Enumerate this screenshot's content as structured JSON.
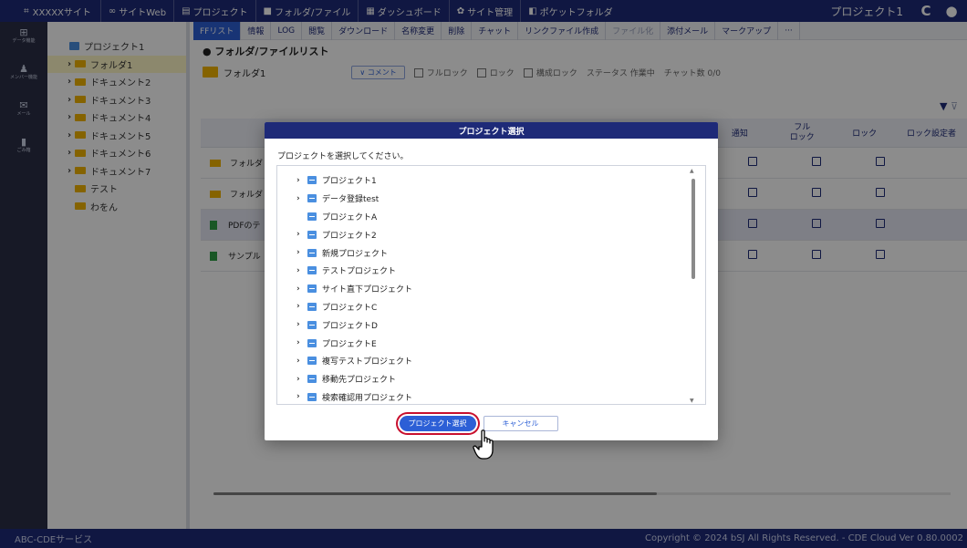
{
  "topbar": {
    "brand": "XXXXXサイト",
    "nav": [
      "サイトWeb",
      "プロジェクト",
      "フォルダ/ファイル",
      "ダッシュボード",
      "サイト管理",
      "ポケットフォルダ"
    ],
    "project_name": "プロジェクト1"
  },
  "rail": [
    "データ機能",
    "メンバー機能",
    "メール",
    "ごみ箱"
  ],
  "tree": {
    "root": "プロジェクト1",
    "items": [
      "フォルダ1",
      "ドキュメント2",
      "ドキュメント3",
      "ドキュメント4",
      "ドキュメント5",
      "ドキュメント6",
      "ドキュメント7",
      "テスト",
      "わをん"
    ]
  },
  "toolbar": [
    "FFリスト",
    "情報",
    "LOG",
    "閲覧",
    "ダウンロード",
    "名称変更",
    "削除",
    "チャット",
    "リンクファイル作成",
    "ファイル化",
    "添付メール",
    "マークアップ",
    "···"
  ],
  "main": {
    "list_title": "● フォルダ/ファイルリスト",
    "folder": "フォルダ1",
    "comment_btn": "∨ コメント",
    "opt_full_lock": "フルロック",
    "opt_lock": "ロック",
    "opt_struct_lock": "構成ロック",
    "status": "ステータス 作業中",
    "chat_count": "チャット数 0/0",
    "headers": [
      "通知",
      "フル\nロック",
      "ロック",
      "ロック設定者"
    ],
    "rows": [
      "フォルダ",
      "フォルダ",
      "PDFのテ",
      "サンプル"
    ]
  },
  "dialog": {
    "title": "プロジェクト選択",
    "message": "プロジェクトを選択してください。",
    "projects": [
      {
        "label": "プロジェクト1",
        "expandable": true
      },
      {
        "label": "データ登録test",
        "expandable": true
      },
      {
        "label": "プロジェクトA",
        "expandable": false
      },
      {
        "label": "プロジェクト2",
        "expandable": true
      },
      {
        "label": "新規プロジェクト",
        "expandable": true
      },
      {
        "label": "テストプロジェクト",
        "expandable": true
      },
      {
        "label": "サイト直下プロジェクト",
        "expandable": true
      },
      {
        "label": "プロジェクトC",
        "expandable": true
      },
      {
        "label": "プロジェクトD",
        "expandable": true
      },
      {
        "label": "プロジェクトE",
        "expandable": true
      },
      {
        "label": "複写テストプロジェクト",
        "expandable": true
      },
      {
        "label": "移動先プロジェクト",
        "expandable": true
      },
      {
        "label": "検索確認用プロジェクト",
        "expandable": true
      }
    ],
    "ok_label": "プロジェクト選択",
    "cancel_label": "キャンセル"
  },
  "footer": {
    "left": "ABC-CDEサービス",
    "right": "Copyright © 2024 bSJ All Rights Reserved. - CDE Cloud Ver 0.80.0002"
  }
}
